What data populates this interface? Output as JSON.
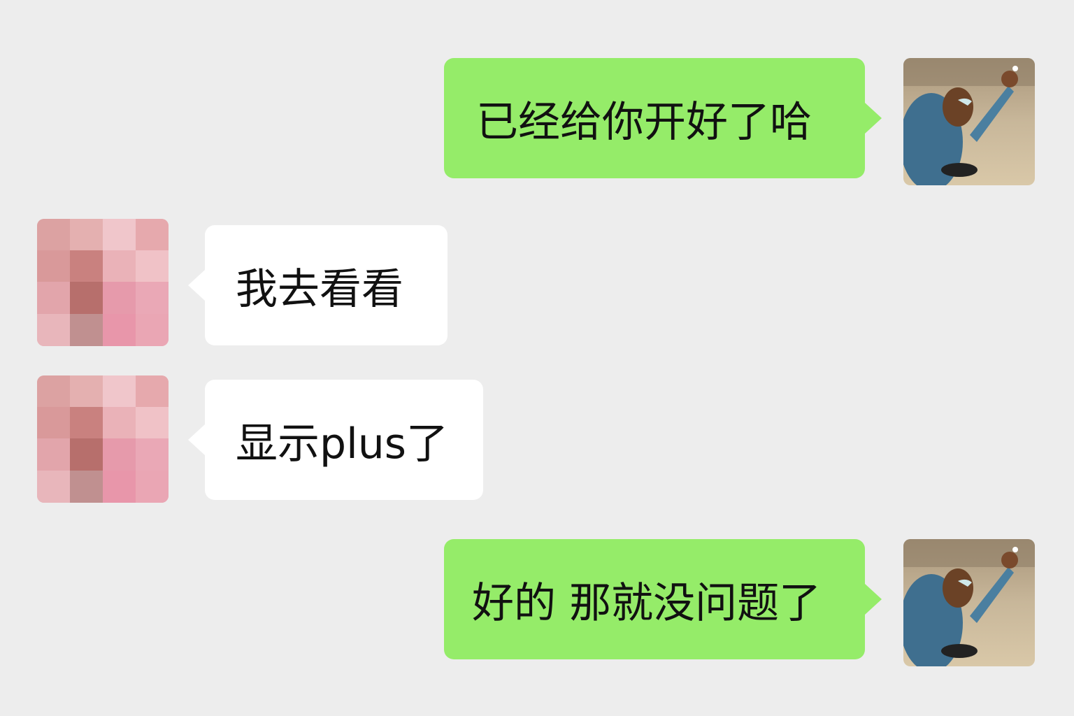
{
  "chat": {
    "messages": [
      {
        "sender": "me",
        "text": "已经给你开好了哈",
        "avatar": "photo-avatar-girl-waving"
      },
      {
        "sender": "other",
        "text": "我去看看",
        "avatar": "pixelated-avatar"
      },
      {
        "sender": "other",
        "text": "显示plus了",
        "avatar": "pixelated-avatar"
      },
      {
        "sender": "me",
        "text": "好的 那就没问题了",
        "avatar": "photo-avatar-girl-waving"
      }
    ]
  },
  "colors": {
    "background": "#ededed",
    "my_bubble": "#95ec69",
    "other_bubble": "#ffffff",
    "text": "#111111"
  }
}
